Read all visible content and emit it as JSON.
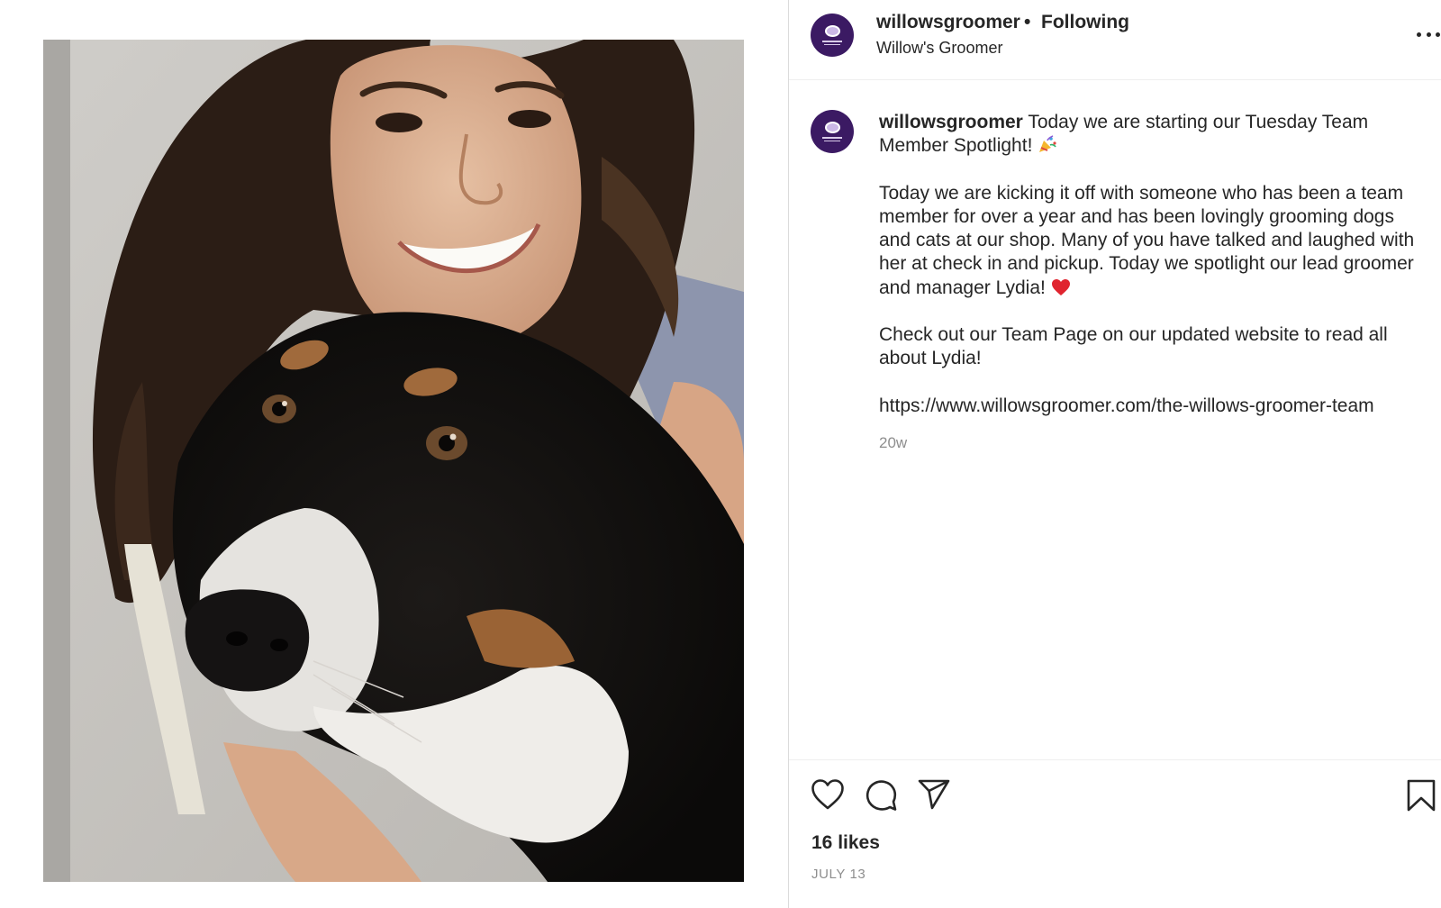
{
  "post": {
    "image_alt": "Woman smiling with black, white and tan dog",
    "colors": {
      "avatar_bg": "#3b1a63",
      "text": "#262626",
      "muted": "#8e8e8e",
      "heart": "#e0242f"
    }
  },
  "header": {
    "username": "willowsgroomer",
    "separator": "•",
    "follow_status": "Following",
    "display_name": "Willow's Groomer",
    "more_icon": "more-options-icon"
  },
  "caption": {
    "username": "willowsgroomer",
    "intro": "Today we are starting our Tuesday Team Member Spotlight!",
    "intro_emoji": "party-popper-emoji",
    "paragraph_1": "Today we are kicking it off with someone who has been a team member for over a year and has been lovingly grooming dogs and cats at our shop. Many of you have talked and laughed with her at check in and pickup. Today we spotlight our lead groomer and manager Lydia!",
    "paragraph_1_emoji": "red-heart-emoji",
    "paragraph_2": "Check out our Team Page on our updated website to read all about Lydia!",
    "link": "https://www.willowsgroomer.com/the-willows-groomer-team",
    "time_ago": "20w"
  },
  "actions": {
    "icons": [
      "heart-icon",
      "comment-icon",
      "share-icon",
      "bookmark-icon"
    ],
    "likes": "16 likes",
    "date": "JULY 13"
  }
}
